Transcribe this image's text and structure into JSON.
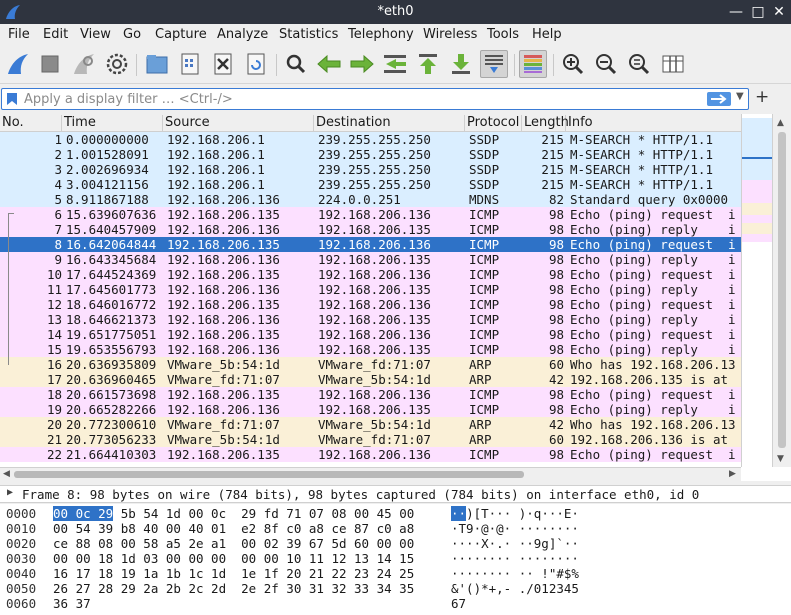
{
  "window": {
    "title": "*eth0"
  },
  "menu": [
    "File",
    "Edit",
    "View",
    "Go",
    "Capture",
    "Analyze",
    "Statistics",
    "Telephony",
    "Wireless",
    "Tools",
    "Help"
  ],
  "filter": {
    "placeholder": "Apply a display filter … <Ctrl-/>"
  },
  "columns": [
    "No.",
    "Time",
    "Source",
    "Destination",
    "Protocol",
    "Length",
    "Info"
  ],
  "packets": [
    {
      "no": "1",
      "time": "0.000000000",
      "src": "192.168.206.1",
      "dst": "239.255.255.250",
      "proto": "SSDP",
      "len": "215",
      "info": "M-SEARCH * HTTP/1.1",
      "kind": "ssdp"
    },
    {
      "no": "2",
      "time": "1.001528091",
      "src": "192.168.206.1",
      "dst": "239.255.255.250",
      "proto": "SSDP",
      "len": "215",
      "info": "M-SEARCH * HTTP/1.1",
      "kind": "ssdp"
    },
    {
      "no": "3",
      "time": "2.002696934",
      "src": "192.168.206.1",
      "dst": "239.255.255.250",
      "proto": "SSDP",
      "len": "215",
      "info": "M-SEARCH * HTTP/1.1",
      "kind": "ssdp"
    },
    {
      "no": "4",
      "time": "3.004121156",
      "src": "192.168.206.1",
      "dst": "239.255.255.250",
      "proto": "SSDP",
      "len": "215",
      "info": "M-SEARCH * HTTP/1.1",
      "kind": "ssdp"
    },
    {
      "no": "5",
      "time": "8.911867188",
      "src": "192.168.206.136",
      "dst": "224.0.0.251",
      "proto": "MDNS",
      "len": "82",
      "info": "Standard query 0x0000",
      "kind": "ssdp"
    },
    {
      "no": "6",
      "time": "15.639607636",
      "src": "192.168.206.135",
      "dst": "192.168.206.136",
      "proto": "ICMP",
      "len": "98",
      "info": "Echo (ping) request  i",
      "kind": "icmp"
    },
    {
      "no": "7",
      "time": "15.640457909",
      "src": "192.168.206.136",
      "dst": "192.168.206.135",
      "proto": "ICMP",
      "len": "98",
      "info": "Echo (ping) reply    i",
      "kind": "icmp"
    },
    {
      "no": "8",
      "time": "16.642064844",
      "src": "192.168.206.135",
      "dst": "192.168.206.136",
      "proto": "ICMP",
      "len": "98",
      "info": "Echo (ping) request  i",
      "kind": "sel"
    },
    {
      "no": "9",
      "time": "16.643345684",
      "src": "192.168.206.136",
      "dst": "192.168.206.135",
      "proto": "ICMP",
      "len": "98",
      "info": "Echo (ping) reply    i",
      "kind": "icmp"
    },
    {
      "no": "10",
      "time": "17.644524369",
      "src": "192.168.206.135",
      "dst": "192.168.206.136",
      "proto": "ICMP",
      "len": "98",
      "info": "Echo (ping) request  i",
      "kind": "icmp"
    },
    {
      "no": "11",
      "time": "17.645601773",
      "src": "192.168.206.136",
      "dst": "192.168.206.135",
      "proto": "ICMP",
      "len": "98",
      "info": "Echo (ping) reply    i",
      "kind": "icmp"
    },
    {
      "no": "12",
      "time": "18.646016772",
      "src": "192.168.206.135",
      "dst": "192.168.206.136",
      "proto": "ICMP",
      "len": "98",
      "info": "Echo (ping) request  i",
      "kind": "icmp"
    },
    {
      "no": "13",
      "time": "18.646621373",
      "src": "192.168.206.136",
      "dst": "192.168.206.135",
      "proto": "ICMP",
      "len": "98",
      "info": "Echo (ping) reply    i",
      "kind": "icmp"
    },
    {
      "no": "14",
      "time": "19.651775051",
      "src": "192.168.206.135",
      "dst": "192.168.206.136",
      "proto": "ICMP",
      "len": "98",
      "info": "Echo (ping) request  i",
      "kind": "icmp"
    },
    {
      "no": "15",
      "time": "19.653556793",
      "src": "192.168.206.136",
      "dst": "192.168.206.135",
      "proto": "ICMP",
      "len": "98",
      "info": "Echo (ping) reply    i",
      "kind": "icmp"
    },
    {
      "no": "16",
      "time": "20.636935809",
      "src": "VMware_5b:54:1d",
      "dst": "VMware_fd:71:07",
      "proto": "ARP",
      "len": "60",
      "info": "Who has 192.168.206.13",
      "kind": "arp"
    },
    {
      "no": "17",
      "time": "20.636960465",
      "src": "VMware_fd:71:07",
      "dst": "VMware_5b:54:1d",
      "proto": "ARP",
      "len": "42",
      "info": "192.168.206.135 is at",
      "kind": "arp"
    },
    {
      "no": "18",
      "time": "20.661573698",
      "src": "192.168.206.135",
      "dst": "192.168.206.136",
      "proto": "ICMP",
      "len": "98",
      "info": "Echo (ping) request  i",
      "kind": "icmp"
    },
    {
      "no": "19",
      "time": "20.665282266",
      "src": "192.168.206.136",
      "dst": "192.168.206.135",
      "proto": "ICMP",
      "len": "98",
      "info": "Echo (ping) reply    i",
      "kind": "icmp"
    },
    {
      "no": "20",
      "time": "20.772300610",
      "src": "VMware_fd:71:07",
      "dst": "VMware_5b:54:1d",
      "proto": "ARP",
      "len": "42",
      "info": "Who has 192.168.206.13",
      "kind": "arp"
    },
    {
      "no": "21",
      "time": "20.773056233",
      "src": "VMware_5b:54:1d",
      "dst": "VMware_fd:71:07",
      "proto": "ARP",
      "len": "60",
      "info": "192.168.206.136 is at",
      "kind": "arp"
    },
    {
      "no": "22",
      "time": "21.664410303",
      "src": "192.168.206.135",
      "dst": "192.168.206.136",
      "proto": "ICMP",
      "len": "98",
      "info": "Echo (ping) request  i",
      "kind": "icmp"
    }
  ],
  "detail": {
    "text": "Frame 8: 98 bytes on wire (784 bits), 98 bytes captured (784 bits) on interface eth0, id 0"
  },
  "bytes": [
    {
      "off": "0000",
      "hex": "00 0c 29 5b 54 1d 00 0c  29 fd 71 07 08 00 45 00",
      "ascii": "··)[T··· )·q···E·"
    },
    {
      "off": "0010",
      "hex": "00 54 39 b8 40 00 40 01  e2 8f c0 a8 ce 87 c0 a8",
      "ascii": "·T9·@·@· ········"
    },
    {
      "off": "0020",
      "hex": "ce 88 08 00 58 a5 2e a1  00 02 39 67 5d 60 00 00",
      "ascii": "····X·.· ··9g]`··"
    },
    {
      "off": "0030",
      "hex": "00 00 18 1d 03 00 00 00  00 00 10 11 12 13 14 15",
      "ascii": "········ ········"
    },
    {
      "off": "0040",
      "hex": "16 17 18 19 1a 1b 1c 1d  1e 1f 20 21 22 23 24 25",
      "ascii": "········ ·· !\"#$%"
    },
    {
      "off": "0050",
      "hex": "26 27 28 29 2a 2b 2c 2d  2e 2f 30 31 32 33 34 35",
      "ascii": "&'()*+,- ./012345"
    },
    {
      "off": "0060",
      "hex": "36 37",
      "ascii": "67"
    }
  ],
  "colors": {
    "ssdp": "#daeeff",
    "icmp": "#fce0ff",
    "arp": "#faf0d7",
    "selected": "#2e72c7",
    "titlebar": "#2f343f",
    "accent": "#5294e2"
  },
  "toolbar_icons": [
    "shark-fin-start-icon",
    "stop-square-icon",
    "restart-fin-icon",
    "capture-options-gear-icon",
    "open-folder-icon",
    "save-file-icon",
    "close-file-icon",
    "reload-icon",
    "find-magnifier-icon",
    "go-back-arrow-icon",
    "go-forward-arrow-icon",
    "go-to-packet-icon",
    "first-packet-icon",
    "last-packet-icon",
    "autoscroll-icon",
    "colorize-icon",
    "zoom-in-icon",
    "zoom-out-icon",
    "zoom-normal-icon",
    "resize-columns-icon"
  ]
}
